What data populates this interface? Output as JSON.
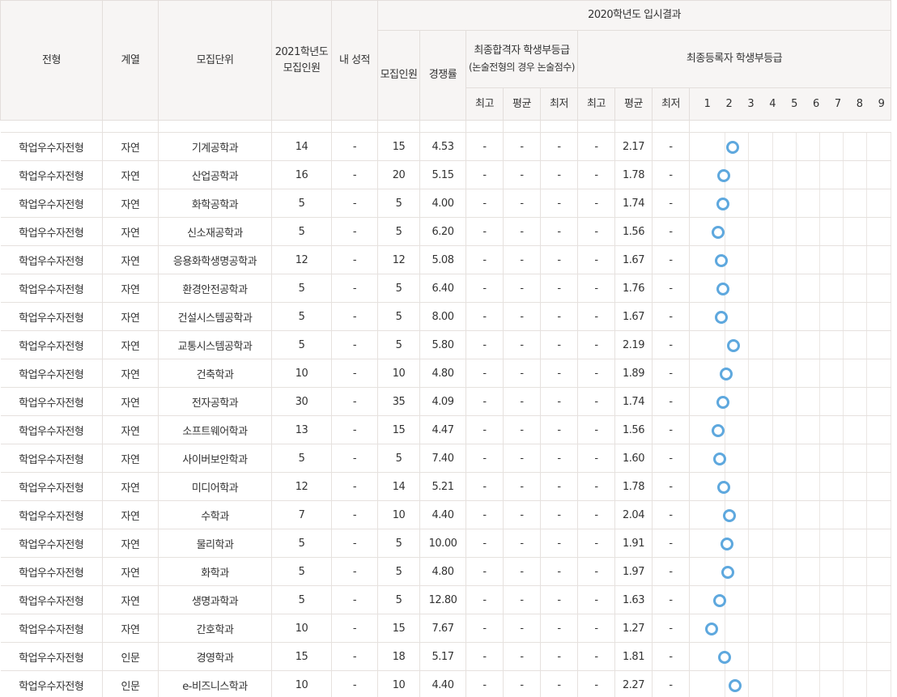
{
  "header": {
    "col_type": "전형",
    "col_field": "계열",
    "col_unit": "모집단위",
    "col_2021_line1": "2021학년도",
    "col_2021_line2": "모집인원",
    "col_my_grade": "내 성적",
    "group_2020": "2020학년도 입시결과",
    "col_recruit": "모집인원",
    "col_ratio": "경쟁률",
    "group_final_pass_line1": "최종합격자 학생부등급",
    "group_final_pass_line2": "(논술전형의 경우 논술점수)",
    "group_final_reg": "최종등록자 학생부등급",
    "sub_max": "최고",
    "sub_avg": "평균",
    "sub_min": "최저",
    "grades": [
      "1",
      "2",
      "3",
      "4",
      "5",
      "6",
      "7",
      "8",
      "9"
    ]
  },
  "dot_color": "#5ea8de",
  "rows": [
    {
      "type": "학업우수자전형",
      "field": "자연",
      "unit": "기계공학과",
      "r2021": "14",
      "my": "-",
      "r2020": "15",
      "ratio": "4.53",
      "p_max": "-",
      "p_avg": "-",
      "p_min": "-",
      "g_max": "-",
      "g_avg": "2.17",
      "g_min": "-",
      "grade": 2.17
    },
    {
      "type": "학업우수자전형",
      "field": "자연",
      "unit": "산업공학과",
      "r2021": "16",
      "my": "-",
      "r2020": "20",
      "ratio": "5.15",
      "p_max": "-",
      "p_avg": "-",
      "p_min": "-",
      "g_max": "-",
      "g_avg": "1.78",
      "g_min": "-",
      "grade": 1.78
    },
    {
      "type": "학업우수자전형",
      "field": "자연",
      "unit": "화학공학과",
      "r2021": "5",
      "my": "-",
      "r2020": "5",
      "ratio": "4.00",
      "p_max": "-",
      "p_avg": "-",
      "p_min": "-",
      "g_max": "-",
      "g_avg": "1.74",
      "g_min": "-",
      "grade": 1.74
    },
    {
      "type": "학업우수자전형",
      "field": "자연",
      "unit": "신소재공학과",
      "r2021": "5",
      "my": "-",
      "r2020": "5",
      "ratio": "6.20",
      "p_max": "-",
      "p_avg": "-",
      "p_min": "-",
      "g_max": "-",
      "g_avg": "1.56",
      "g_min": "-",
      "grade": 1.56
    },
    {
      "type": "학업우수자전형",
      "field": "자연",
      "unit": "응용화학생명공학과",
      "r2021": "12",
      "my": "-",
      "r2020": "12",
      "ratio": "5.08",
      "p_max": "-",
      "p_avg": "-",
      "p_min": "-",
      "g_max": "-",
      "g_avg": "1.67",
      "g_min": "-",
      "grade": 1.67
    },
    {
      "type": "학업우수자전형",
      "field": "자연",
      "unit": "환경안전공학과",
      "r2021": "5",
      "my": "-",
      "r2020": "5",
      "ratio": "6.40",
      "p_max": "-",
      "p_avg": "-",
      "p_min": "-",
      "g_max": "-",
      "g_avg": "1.76",
      "g_min": "-",
      "grade": 1.76
    },
    {
      "type": "학업우수자전형",
      "field": "자연",
      "unit": "건설시스템공학과",
      "r2021": "5",
      "my": "-",
      "r2020": "5",
      "ratio": "8.00",
      "p_max": "-",
      "p_avg": "-",
      "p_min": "-",
      "g_max": "-",
      "g_avg": "1.67",
      "g_min": "-",
      "grade": 1.67
    },
    {
      "type": "학업우수자전형",
      "field": "자연",
      "unit": "교통시스템공학과",
      "r2021": "5",
      "my": "-",
      "r2020": "5",
      "ratio": "5.80",
      "p_max": "-",
      "p_avg": "-",
      "p_min": "-",
      "g_max": "-",
      "g_avg": "2.19",
      "g_min": "-",
      "grade": 2.19
    },
    {
      "type": "학업우수자전형",
      "field": "자연",
      "unit": "건축학과",
      "r2021": "10",
      "my": "-",
      "r2020": "10",
      "ratio": "4.80",
      "p_max": "-",
      "p_avg": "-",
      "p_min": "-",
      "g_max": "-",
      "g_avg": "1.89",
      "g_min": "-",
      "grade": 1.89
    },
    {
      "type": "학업우수자전형",
      "field": "자연",
      "unit": "전자공학과",
      "r2021": "30",
      "my": "-",
      "r2020": "35",
      "ratio": "4.09",
      "p_max": "-",
      "p_avg": "-",
      "p_min": "-",
      "g_max": "-",
      "g_avg": "1.74",
      "g_min": "-",
      "grade": 1.74
    },
    {
      "type": "학업우수자전형",
      "field": "자연",
      "unit": "소프트웨어학과",
      "r2021": "13",
      "my": "-",
      "r2020": "15",
      "ratio": "4.47",
      "p_max": "-",
      "p_avg": "-",
      "p_min": "-",
      "g_max": "-",
      "g_avg": "1.56",
      "g_min": "-",
      "grade": 1.56
    },
    {
      "type": "학업우수자전형",
      "field": "자연",
      "unit": "사이버보안학과",
      "r2021": "5",
      "my": "-",
      "r2020": "5",
      "ratio": "7.40",
      "p_max": "-",
      "p_avg": "-",
      "p_min": "-",
      "g_max": "-",
      "g_avg": "1.60",
      "g_min": "-",
      "grade": 1.6
    },
    {
      "type": "학업우수자전형",
      "field": "자연",
      "unit": "미디어학과",
      "r2021": "12",
      "my": "-",
      "r2020": "14",
      "ratio": "5.21",
      "p_max": "-",
      "p_avg": "-",
      "p_min": "-",
      "g_max": "-",
      "g_avg": "1.78",
      "g_min": "-",
      "grade": 1.78
    },
    {
      "type": "학업우수자전형",
      "field": "자연",
      "unit": "수학과",
      "r2021": "7",
      "my": "-",
      "r2020": "10",
      "ratio": "4.40",
      "p_max": "-",
      "p_avg": "-",
      "p_min": "-",
      "g_max": "-",
      "g_avg": "2.04",
      "g_min": "-",
      "grade": 2.04
    },
    {
      "type": "학업우수자전형",
      "field": "자연",
      "unit": "물리학과",
      "r2021": "5",
      "my": "-",
      "r2020": "5",
      "ratio": "10.00",
      "p_max": "-",
      "p_avg": "-",
      "p_min": "-",
      "g_max": "-",
      "g_avg": "1.91",
      "g_min": "-",
      "grade": 1.91
    },
    {
      "type": "학업우수자전형",
      "field": "자연",
      "unit": "화학과",
      "r2021": "5",
      "my": "-",
      "r2020": "5",
      "ratio": "4.80",
      "p_max": "-",
      "p_avg": "-",
      "p_min": "-",
      "g_max": "-",
      "g_avg": "1.97",
      "g_min": "-",
      "grade": 1.97
    },
    {
      "type": "학업우수자전형",
      "field": "자연",
      "unit": "생명과학과",
      "r2021": "5",
      "my": "-",
      "r2020": "5",
      "ratio": "12.80",
      "p_max": "-",
      "p_avg": "-",
      "p_min": "-",
      "g_max": "-",
      "g_avg": "1.63",
      "g_min": "-",
      "grade": 1.63
    },
    {
      "type": "학업우수자전형",
      "field": "자연",
      "unit": "간호학과",
      "r2021": "10",
      "my": "-",
      "r2020": "15",
      "ratio": "7.67",
      "p_max": "-",
      "p_avg": "-",
      "p_min": "-",
      "g_max": "-",
      "g_avg": "1.27",
      "g_min": "-",
      "grade": 1.27
    },
    {
      "type": "학업우수자전형",
      "field": "인문",
      "unit": "경영학과",
      "r2021": "15",
      "my": "-",
      "r2020": "18",
      "ratio": "5.17",
      "p_max": "-",
      "p_avg": "-",
      "p_min": "-",
      "g_max": "-",
      "g_avg": "1.81",
      "g_min": "-",
      "grade": 1.81
    },
    {
      "type": "학업우수자전형",
      "field": "인문",
      "unit": "e-비즈니스학과",
      "r2021": "10",
      "my": "-",
      "r2020": "10",
      "ratio": "4.40",
      "p_max": "-",
      "p_avg": "-",
      "p_min": "-",
      "g_max": "-",
      "g_avg": "2.27",
      "g_min": "-",
      "grade": 2.27
    }
  ]
}
